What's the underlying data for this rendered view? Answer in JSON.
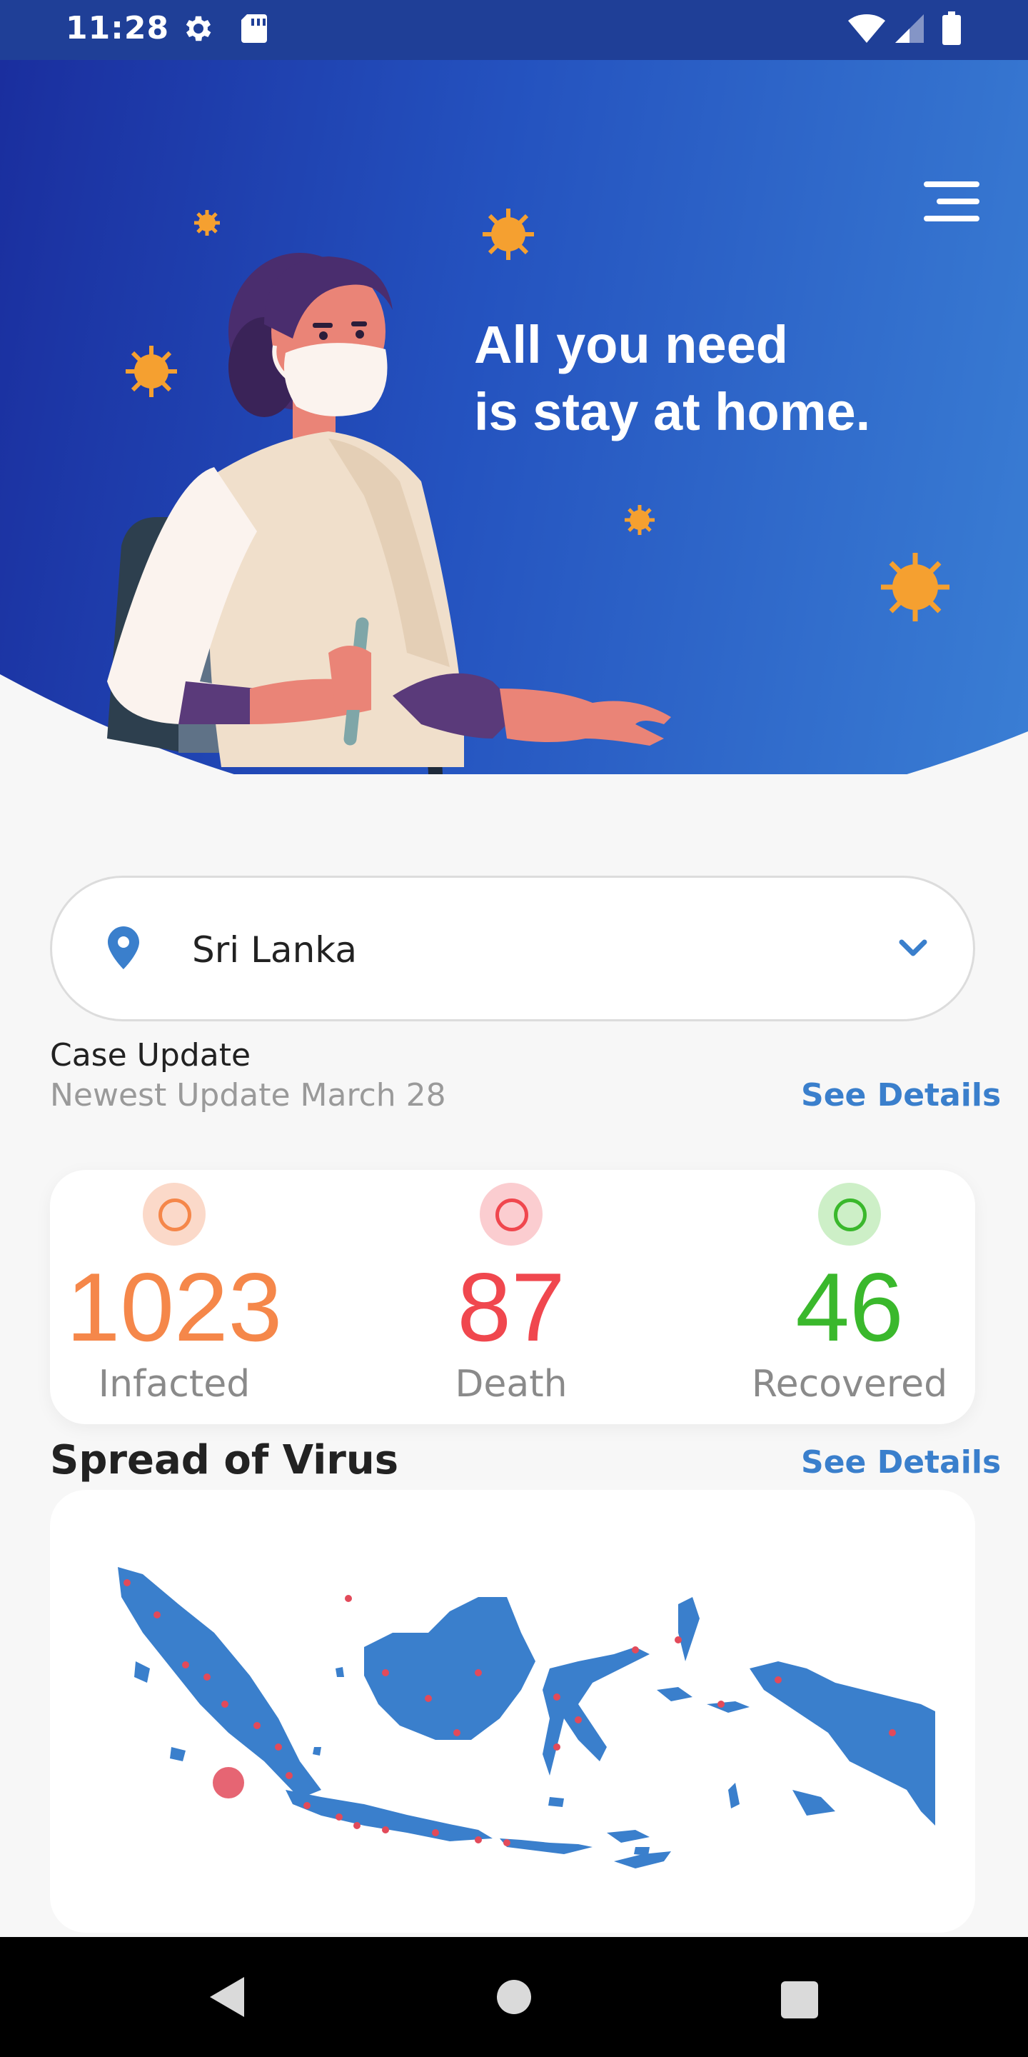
{
  "status_bar": {
    "time": "11:28",
    "left_icons": [
      "gear-icon",
      "sd-card-icon"
    ],
    "right_icons": [
      "wifi-icon",
      "signal-icon",
      "battery-icon"
    ]
  },
  "header": {
    "headline_line1": "All you need",
    "headline_line2": "is stay at home.",
    "menu_icon": "hamburger-icon",
    "illustration": "woman-with-mask-and-test-tube",
    "gradient_colors": [
      "#1a2e9e",
      "#3a7ed4"
    ],
    "virus_color": "#f5a030"
  },
  "location": {
    "icon": "location-pin-icon",
    "country": "Sri Lanka",
    "dropdown_icon": "chevron-down-icon"
  },
  "case_update": {
    "title": "Case Update",
    "subtitle": "Newest Update March 28",
    "see_details": "See Details"
  },
  "stats": [
    {
      "value": "1023",
      "label": "Infacted",
      "color": "#f5874a",
      "ring_bg": "#fbd9c9"
    },
    {
      "value": "87",
      "label": "Death",
      "color": "#f0474e",
      "ring_bg": "#fbcdd0"
    },
    {
      "value": "46",
      "label": "Recovered",
      "color": "#3ab82c",
      "ring_bg": "#cdefc7"
    }
  ],
  "spread": {
    "title": "Spread of Virus",
    "see_details": "See Details",
    "map": "indonesia-map",
    "map_color": "#3a7fcc",
    "hotspot_color": "#e24a5a"
  },
  "nav_bar": {
    "buttons": [
      "back-icon",
      "home-icon",
      "recents-icon"
    ]
  }
}
